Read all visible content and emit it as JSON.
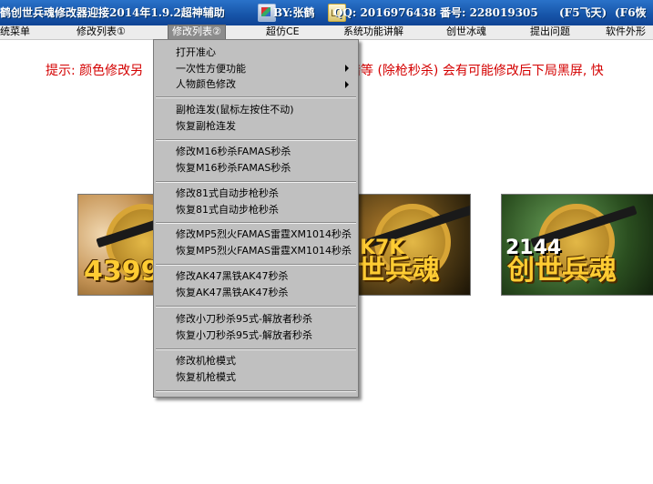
{
  "title": {
    "main": "鹤创世兵魂修改器迎接2014年1.9.2超神辅助",
    "by": "BY:张鹤",
    "qq": "QQ: 2016976438",
    "fanhao": "番号: 228019305",
    "f5": "(F5飞天)",
    "f6": "(F6恢"
  },
  "menubar": {
    "items": [
      {
        "label": "统菜单"
      },
      {
        "label": "修改列表①"
      },
      {
        "label": "修改列表②"
      },
      {
        "label": "超仿CE"
      },
      {
        "label": "系统功能讲解"
      },
      {
        "label": "创世冰魂"
      },
      {
        "label": "提出问题"
      },
      {
        "label": "软件外形"
      }
    ]
  },
  "notice": {
    "left": "提示: 颜色修改另",
    "right": "猎等 (除枪秒杀) 会有可能修改后下局黑屏, 快"
  },
  "banners": [
    {
      "text": "4399"
    },
    {
      "sub": "K7K",
      "text": "世兵魂"
    },
    {
      "sub": "2144",
      "text": "创世兵魂"
    }
  ],
  "dropdown": {
    "items": [
      "打开准心",
      "一次性方便功能",
      "人物颜色修改",
      "副枪连发(鼠标左按住不动)",
      "恢复副枪连发",
      "修改M16秒杀FAMAS秒杀",
      "恢复M16秒杀FAMAS秒杀",
      "修改81式自动步枪秒杀",
      "恢复81式自动步枪秒杀",
      "修改MP5烈火FAMAS雷霆XM1014秒杀",
      "恢复MP5烈火FAMAS雷霆XM1014秒杀",
      "修改AK47黑铁AK47秒杀",
      "恢复AK47黑铁AK47秒杀",
      "修改小刀秒杀95式-解放者秒杀",
      "恢复小刀秒杀95式-解放者秒杀",
      "修改机枪模式",
      "恢复机枪模式"
    ]
  },
  "icons": [
    "app-icon",
    "picture-icon",
    "mail-icon",
    "submenu-arrow-icon"
  ]
}
